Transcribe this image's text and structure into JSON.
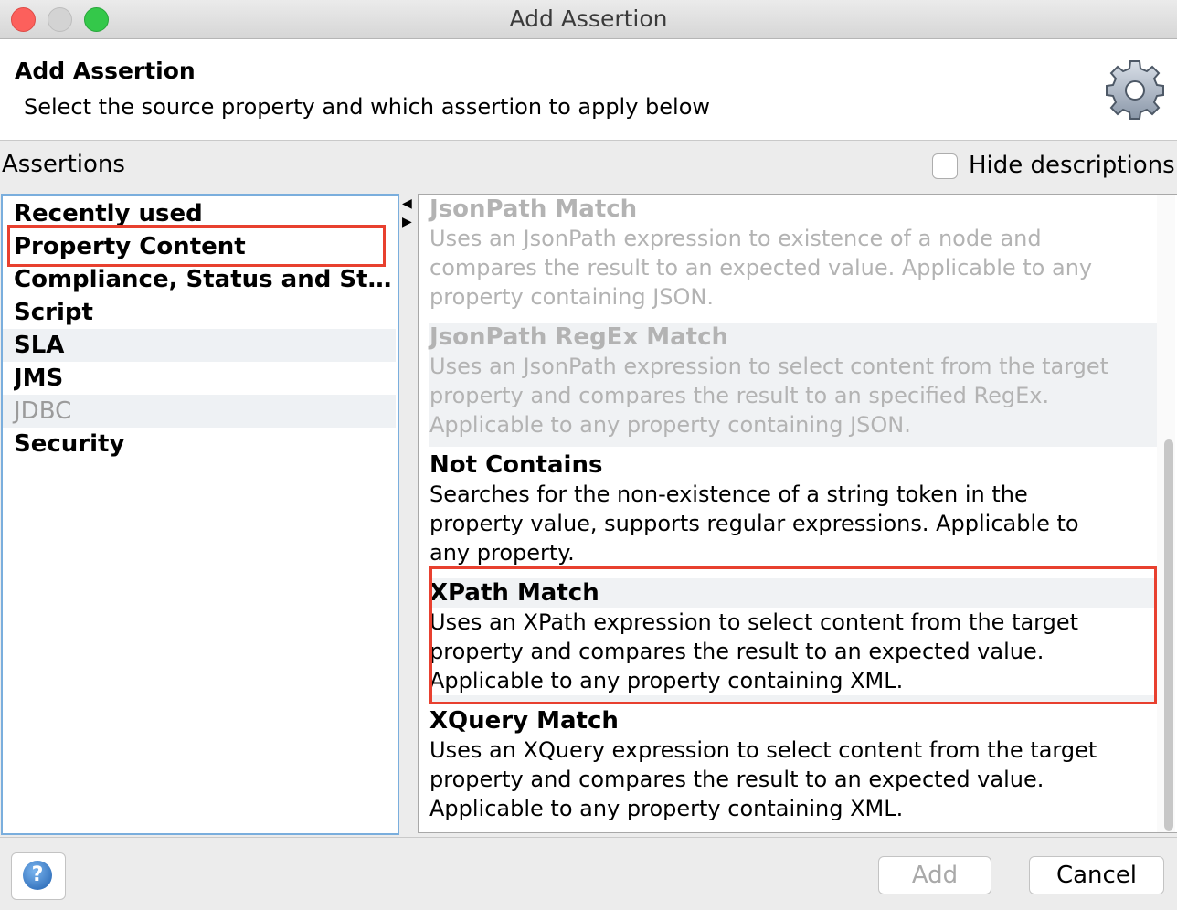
{
  "window": {
    "title": "Add Assertion",
    "controls": [
      "close",
      "minimize",
      "maximize"
    ]
  },
  "header": {
    "title": "Add Assertion",
    "subtitle": "Select the source property and which assertion to apply below",
    "icon": "gear-icon"
  },
  "assertions_label": "Assertions",
  "hide_descriptions": {
    "label": "Hide descriptions",
    "checked": false
  },
  "categories": [
    {
      "label": "Recently used",
      "enabled": true
    },
    {
      "label": "Property Content",
      "enabled": true,
      "highlighted": true
    },
    {
      "label": "Compliance, Status and Stand...",
      "enabled": true
    },
    {
      "label": "Script",
      "enabled": true
    },
    {
      "label": "SLA",
      "enabled": true
    },
    {
      "label": "JMS",
      "enabled": true
    },
    {
      "label": "JDBC",
      "enabled": false
    },
    {
      "label": "Security",
      "enabled": true
    }
  ],
  "assertion_items": [
    {
      "title": "JsonPath Match",
      "enabled": false,
      "description": [
        "Uses an JsonPath expression to existence of a node and",
        "compares the result to an expected value. Applicable to any",
        "property containing JSON."
      ]
    },
    {
      "title": "JsonPath RegEx Match",
      "enabled": false,
      "description": [
        "Uses an JsonPath expression to select content from the target",
        "property and compares the result to an specified RegEx.",
        "Applicable to any property containing JSON."
      ]
    },
    {
      "title": "Not Contains",
      "enabled": true,
      "description": [
        "Searches for the non-existence of a string token in the",
        "property value, supports regular expressions. Applicable to",
        "any property."
      ]
    },
    {
      "title": "XPath Match",
      "enabled": true,
      "highlighted": true,
      "description": [
        "Uses an XPath expression to select content from the target",
        "property and compares the result to an expected value.",
        "Applicable to any property containing XML."
      ]
    },
    {
      "title": "XQuery Match",
      "enabled": true,
      "description": [
        "Uses an XQuery expression to select content from the target",
        "property and compares the result to an expected value.",
        "Applicable to any property containing XML."
      ]
    }
  ],
  "footer": {
    "help_icon": "help-icon",
    "help_glyph": "?",
    "add_label": "Add",
    "add_enabled": false,
    "cancel_label": "Cancel"
  },
  "colors": {
    "highlight_border": "#e8402f",
    "list_border": "#7aaedd",
    "disabled_text": "#b3b3b3"
  }
}
